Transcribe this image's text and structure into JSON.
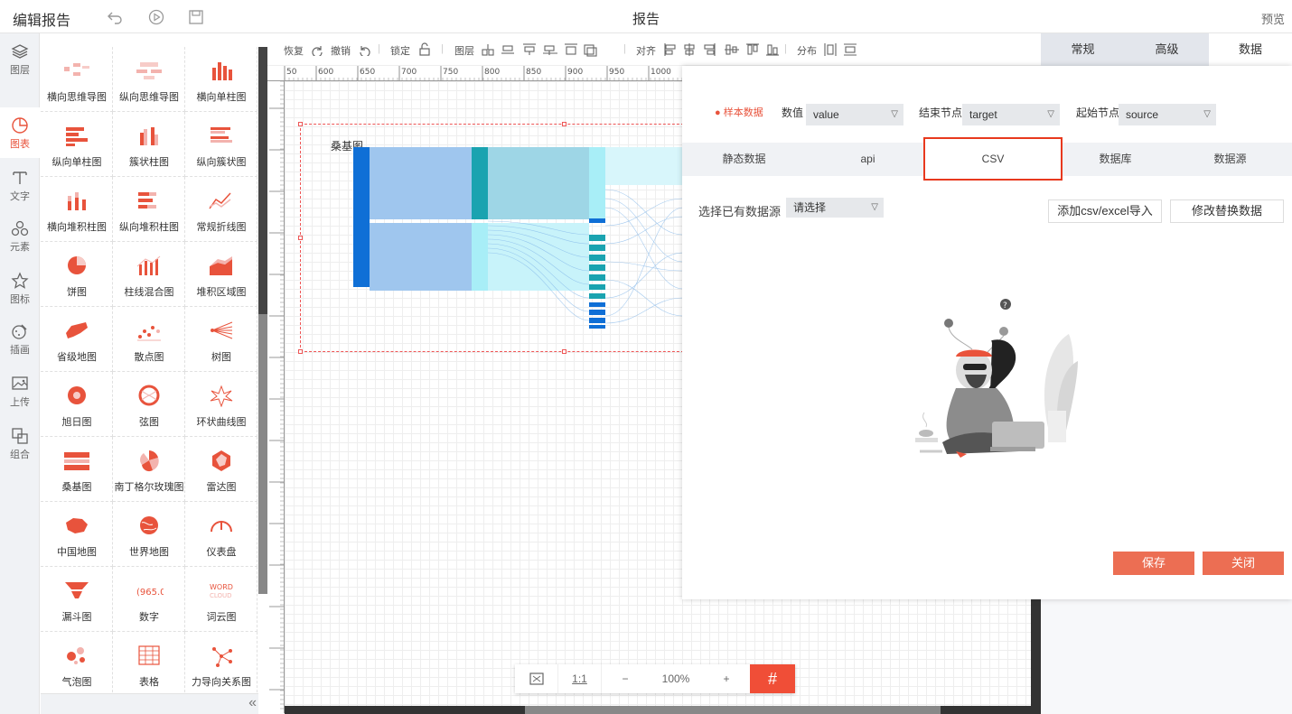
{
  "header": {
    "title": "编辑报告",
    "center_title": "报告",
    "preview": "预览"
  },
  "left_nav": [
    {
      "label": "图层",
      "icon": "layers-icon"
    },
    {
      "label": "图表",
      "icon": "chart-icon"
    },
    {
      "label": "文字",
      "icon": "text-icon"
    },
    {
      "label": "元素",
      "icon": "elements-icon"
    },
    {
      "label": "图标",
      "icon": "star-icon"
    },
    {
      "label": "插画",
      "icon": "illustration-icon"
    },
    {
      "label": "上传",
      "icon": "upload-icon"
    },
    {
      "label": "组合",
      "icon": "group-icon"
    }
  ],
  "chart_library": [
    "横向思维导图",
    "纵向思维导图",
    "横向单柱图",
    "纵向单柱图",
    "簇状柱图",
    "纵向簇状图",
    "横向堆积柱图",
    "纵向堆积柱图",
    "常规折线图",
    "饼图",
    "柱线混合图",
    "堆积区域图",
    "省级地图",
    "散点图",
    "树图",
    "旭日图",
    "弦图",
    "环状曲线图",
    "桑基图",
    "南丁格尔玫瑰图",
    "雷达图",
    "中国地图",
    "世界地图",
    "仪表盘",
    "漏斗图",
    "数字",
    "词云图",
    "气泡图",
    "表格",
    "力导向关系图"
  ],
  "toolbar": {
    "redo": "恢复",
    "undo": "撤销",
    "lock": "锁定",
    "layer": "图层",
    "align": "对齐",
    "distribute": "分布"
  },
  "ruler_top": [
    "50",
    "600",
    "650",
    "700",
    "750",
    "800",
    "850",
    "900",
    "950",
    "1000"
  ],
  "canvas": {
    "chart_title": "桑基图"
  },
  "zoom": {
    "ratio": "1:1",
    "minus": "−",
    "level": "100%",
    "plus": "+"
  },
  "right_tabs": [
    "常规",
    "高级",
    "数据"
  ],
  "dialog": {
    "sample_label": "样本数据",
    "value_label": "数值",
    "value_select": "value",
    "end_label": "结束节点",
    "end_select": "target",
    "start_label": "起始节点",
    "start_select": "source",
    "source_tabs": [
      "静态数据",
      "api",
      "CSV",
      "数据库",
      "数据源"
    ],
    "active_tab": "CSV",
    "existing_label": "选择已有数据源",
    "existing_select": "请选择",
    "import_btn": "添加csv/excel导入",
    "modify_btn": "修改替换数据",
    "save_btn": "保存",
    "close_btn": "关闭"
  },
  "colors": {
    "accent": "#e8533c",
    "dark_blue": "#0f6fd6",
    "teal": "#1aa3b0",
    "light_cyan": "#a8eef7"
  }
}
